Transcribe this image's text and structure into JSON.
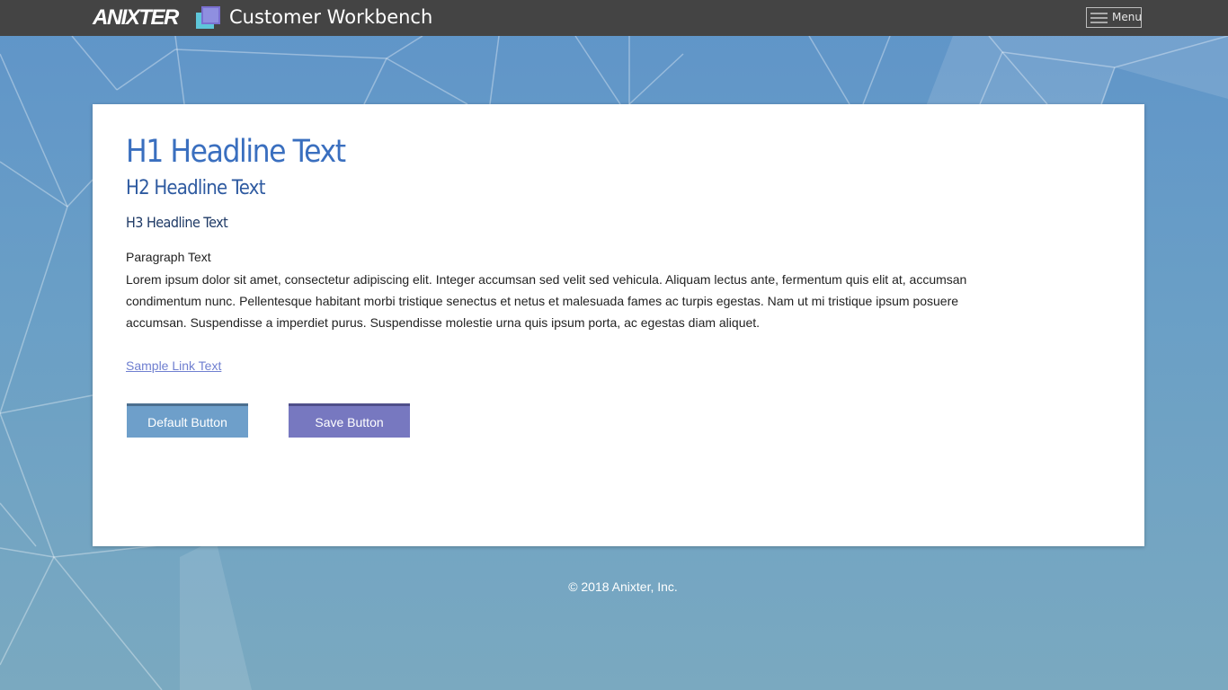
{
  "header": {
    "logo_text": "ANIXTER",
    "app_title": "Customer Workbench",
    "menu_label": "Menu"
  },
  "content": {
    "h1": "H1 Headline Text",
    "h2": "H2 Headline Text",
    "h3": "H3 Headline Text",
    "paragraph_label": "Paragraph Text",
    "paragraph": "Lorem ipsum dolor sit amet, consectetur adipiscing elit. Integer accumsan sed velit sed vehicula. Aliquam lectus ante, fermentum quis elit at, accumsan condimentum nunc. Pellentesque habitant morbi tristique senectus et netus et malesuada fames ac turpis egestas. Nam ut mi tristique ipsum posuere accumsan. Suspendisse a imperdiet purus. Suspendisse molestie urna quis ipsum porta, ac egestas diam aliquet.",
    "link_text": "Sample Link Text",
    "default_button": "Default Button",
    "save_button": "Save Button"
  },
  "footer": {
    "copyright": "© 2018 Anixter, Inc."
  },
  "colors": {
    "topbar": "#444444",
    "heading_blue": "#3a6fbf",
    "link": "#6f7fd0",
    "default_button": "#6e9fca",
    "save_button": "#7778c0",
    "background": "#6a9fc6"
  },
  "icons": {
    "app_icon": "stacked-squares-icon",
    "menu_icon": "hamburger-icon"
  }
}
